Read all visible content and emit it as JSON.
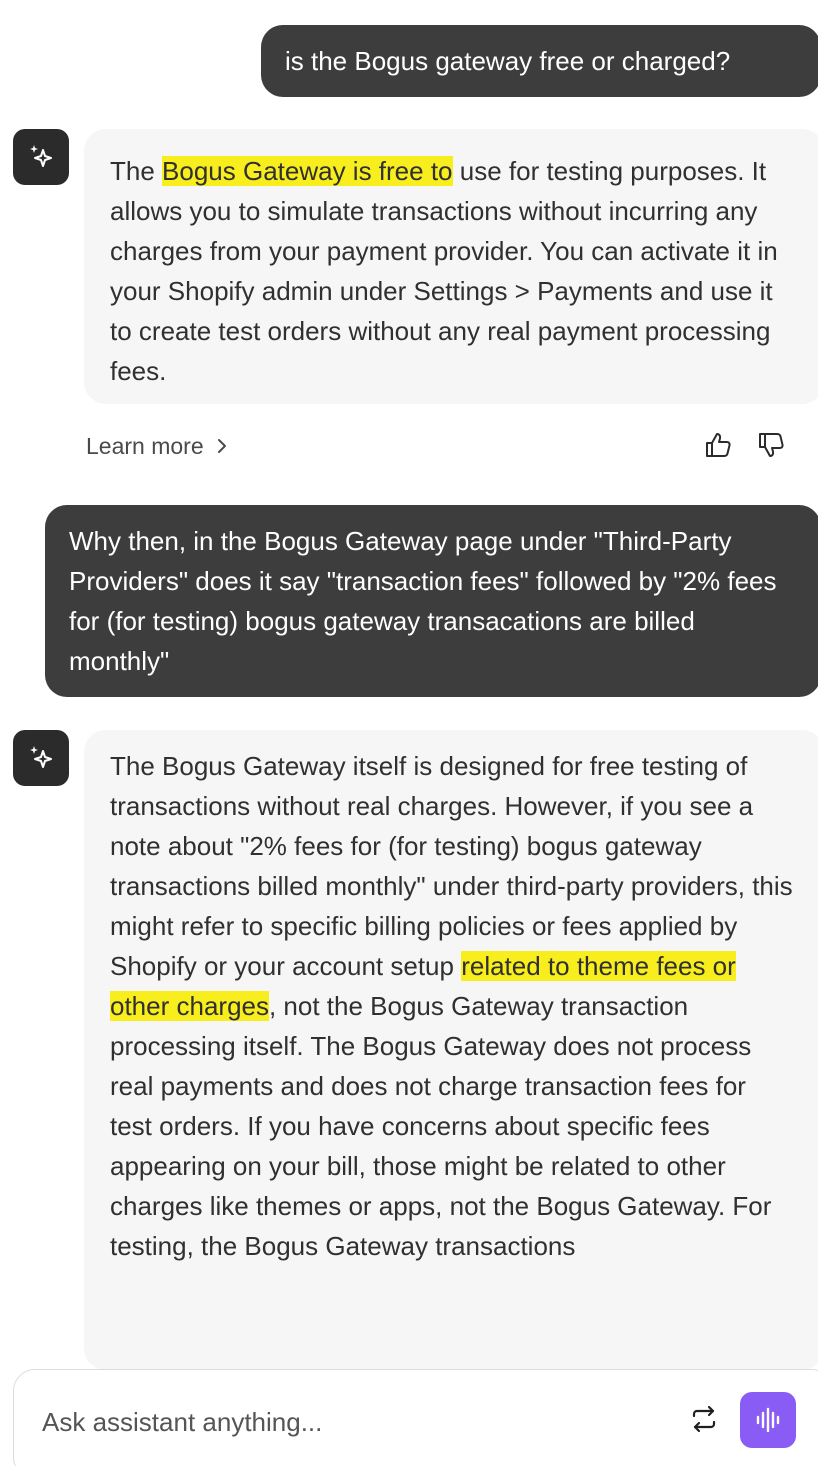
{
  "colors": {
    "user_bubble": "#3d3d3d",
    "assistant_bubble": "#f6f6f7",
    "highlight": "#f8ee1e",
    "voice_button": "#8a5cf6"
  },
  "conversation": {
    "user_message_1": "is the Bogus gateway free or charged?",
    "assistant_message_1": {
      "pre": "The ",
      "highlight": "Bogus Gateway is free to",
      "post": " use for testing purposes. It allows you to simulate transactions without incurring any charges from your payment provider. You can activate it in your Shopify admin under Settings > Payments and use it to create test orders without any real payment processing fees."
    },
    "learn_more_label": "Learn more",
    "user_message_2": "Why then, in the Bogus Gateway page under \"Third-Party Providers\" does it say \"transaction fees\" followed by \"2% fees for (for testing) bogus gateway transacations are billed monthly\"",
    "assistant_message_2": {
      "pre": "The Bogus Gateway itself is designed for free testing of transactions without real charges. However, if you see a note about \"2% fees for (for testing) bogus gateway transactions billed monthly\" under third-party providers, this might refer to specific billing policies or fees applied by Shopify or your account setup ",
      "highlight": "related to theme fees or other charges",
      "post": ", not the Bogus Gateway transaction processing itself. The Bogus Gateway does not process real payments and does not charge transaction fees for test orders. If you have concerns about specific fees appearing on your bill, those might be related to other charges like themes or apps, not the Bogus Gateway. For testing, the Bogus Gateway transactions"
    }
  },
  "composer": {
    "placeholder": "Ask assistant anything..."
  },
  "icons": {
    "assistant_avatar": "sparkle-icon",
    "learn_more_chevron": "chevron-right-icon",
    "thumbs_up": "thumbs-up-icon",
    "thumbs_down": "thumbs-down-icon",
    "swap": "swap-arrows-icon",
    "voice": "voice-waveform-icon"
  }
}
